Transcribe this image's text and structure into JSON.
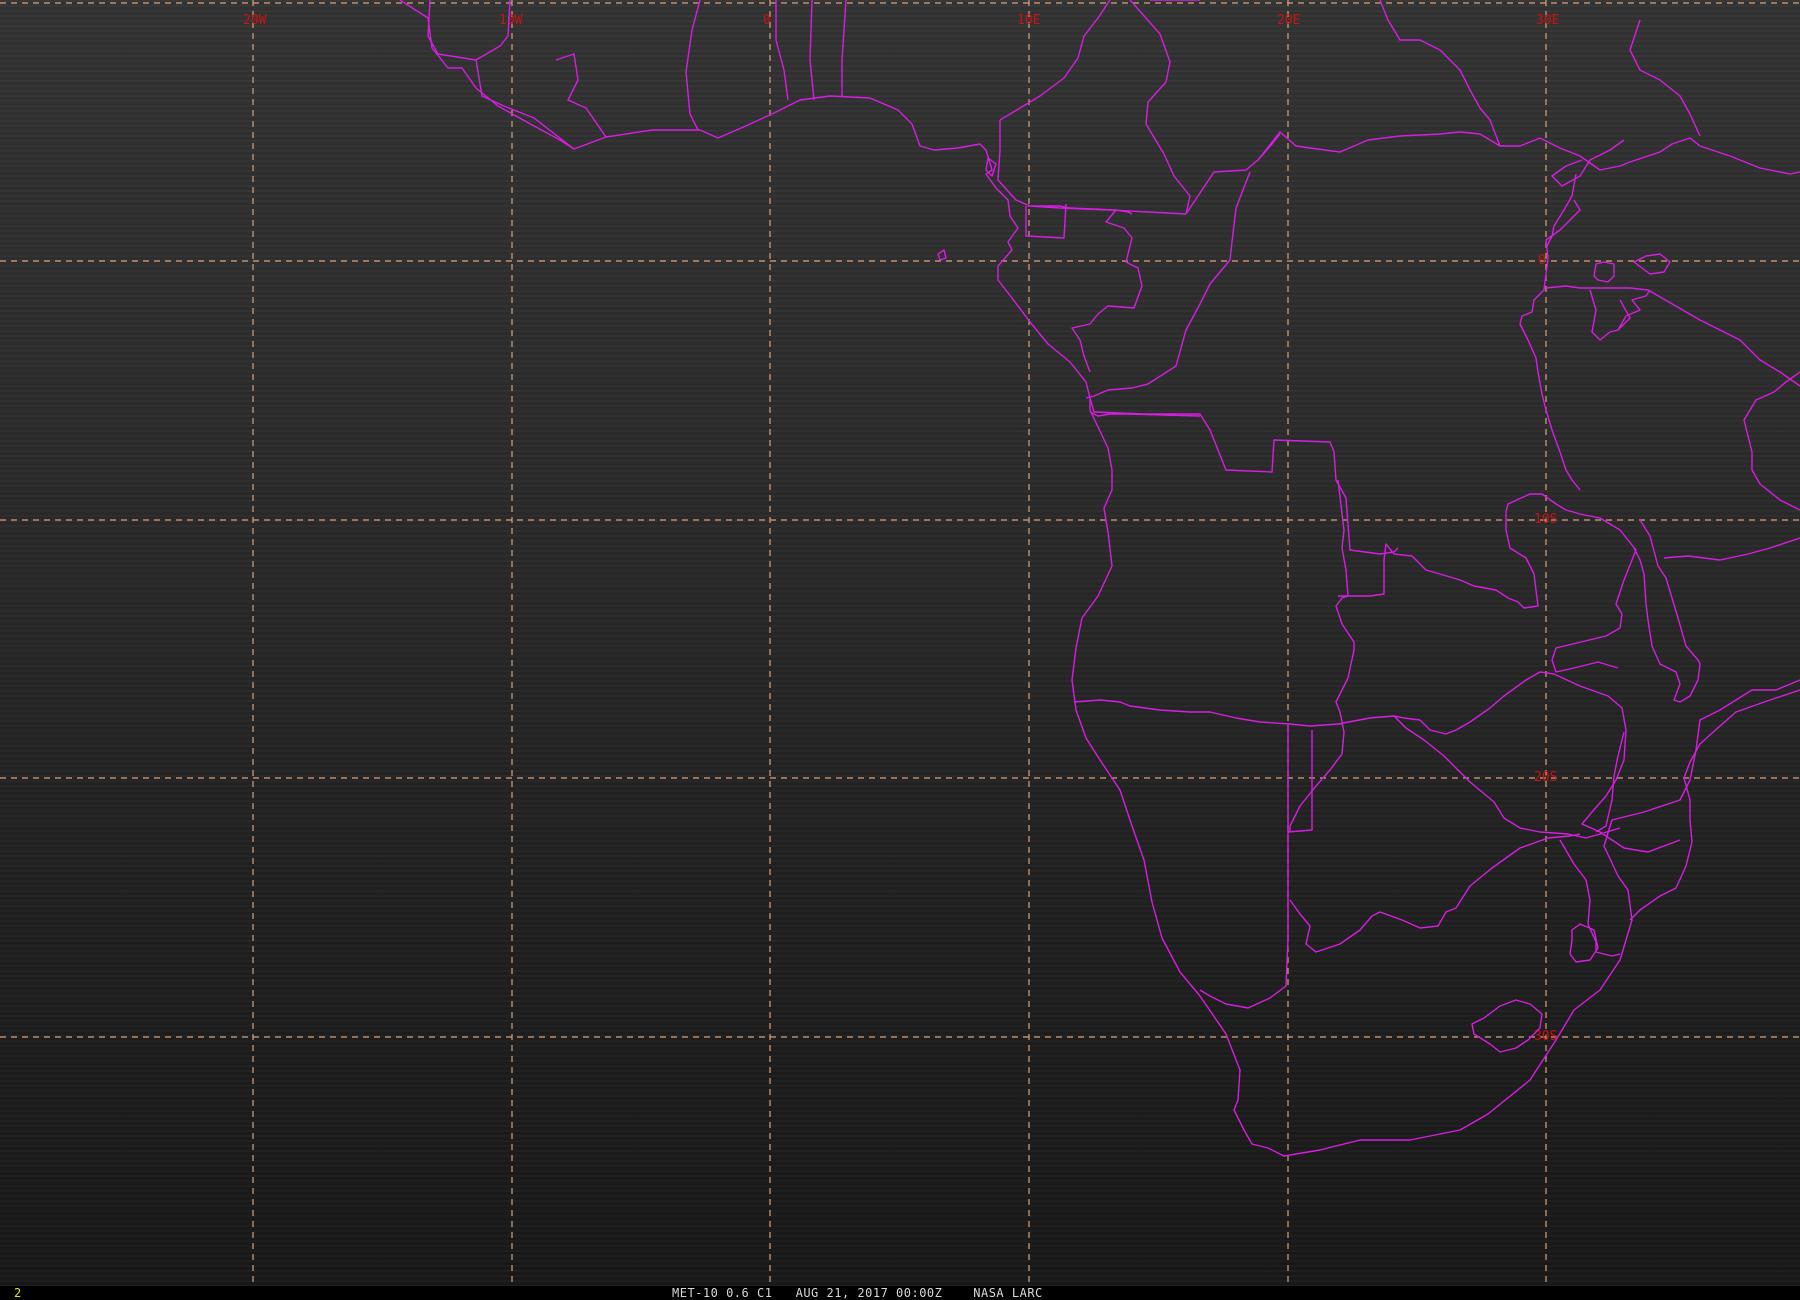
{
  "map": {
    "projection_grid": {
      "longitudes": [
        {
          "label": "20W"
        },
        {
          "label": "10W"
        },
        {
          "label": "0"
        },
        {
          "label": "10E"
        },
        {
          "label": "20E"
        },
        {
          "label": "30E"
        }
      ],
      "latitudes": [
        {
          "label": "0"
        },
        {
          "label": "10S"
        },
        {
          "label": "20S"
        },
        {
          "label": "30S"
        }
      ]
    },
    "colors": {
      "grid": "#d9a27a",
      "grid_labels": "#c81414",
      "political_borders": "#d61ee0",
      "frame_number": "#e8e800"
    },
    "layers": [
      "satellite-visible-imagery",
      "lat-lon-grid",
      "political-boundaries"
    ]
  },
  "status_bar": {
    "frame_number": "2",
    "caption": "MET-10 0.6 C1   AUG 21, 2017 00:00Z    NASA LARC"
  }
}
